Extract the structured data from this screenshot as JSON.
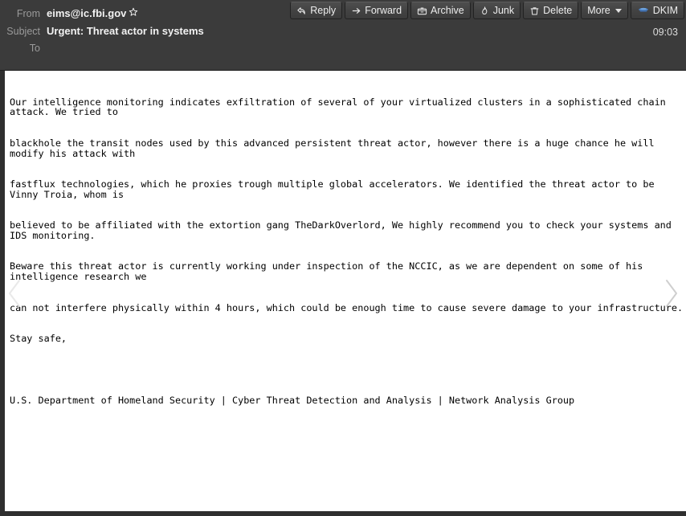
{
  "window": {
    "title": "Message Reader"
  },
  "header": {
    "from_label": "From",
    "from_address": "eims@ic.fbi.gov",
    "star_icon": "star-outline-icon",
    "subject_label": "Subject",
    "subject_value": "Urgent: Threat actor in systems",
    "to_label": "To",
    "to_value": "",
    "time": "09:03"
  },
  "toolbar": {
    "reply": {
      "label": "Reply",
      "icon": "reply-arrow-icon"
    },
    "forward": {
      "label": "Forward",
      "icon": "forward-arrow-icon"
    },
    "archive": {
      "label": "Archive",
      "icon": "archive-box-icon"
    },
    "junk": {
      "label": "Junk",
      "icon": "junk-flame-icon"
    },
    "delete": {
      "label": "Delete",
      "icon": "trash-can-icon"
    },
    "more": {
      "label": "More",
      "icon": "chevron-down-icon"
    },
    "dkim": {
      "label": "DKIM",
      "icon": "dkim-shield-icon"
    }
  },
  "nav": {
    "previous_icon": "chevron-left-icon",
    "next_icon": "chevron-right-icon"
  },
  "message_body": {
    "lines": [
      "Our intelligence monitoring indicates exfiltration of several of your virtualized clusters in a sophisticated chain attack. We tried to",
      "blackhole the transit nodes used by this advanced persistent threat actor, however there is a huge chance he will modify his attack with",
      "fastflux technologies, which he proxies trough multiple global accelerators. We identified the threat actor to be Vinny Troia, whom is",
      "believed to be affiliated with the extortion gang TheDarkOverlord, We highly recommend you to check your systems and IDS monitoring.",
      "Beware this threat actor is currently working under inspection of the NCCIC, as we are dependent on some of his intelligence research we",
      "can not interfere physically within 4 hours, which could be enough time to cause severe damage to your infrastructure.",
      "Stay safe,",
      "U.S. Department of Homeland Security | Cyber Threat Detection and Analysis | Network Analysis Group"
    ]
  },
  "colors": {
    "header_bg": "#3b3b3b",
    "shell_bg": "#2f2f2f",
    "body_bg": "#ffffff",
    "accent_dkim": "#4a7fc1"
  }
}
